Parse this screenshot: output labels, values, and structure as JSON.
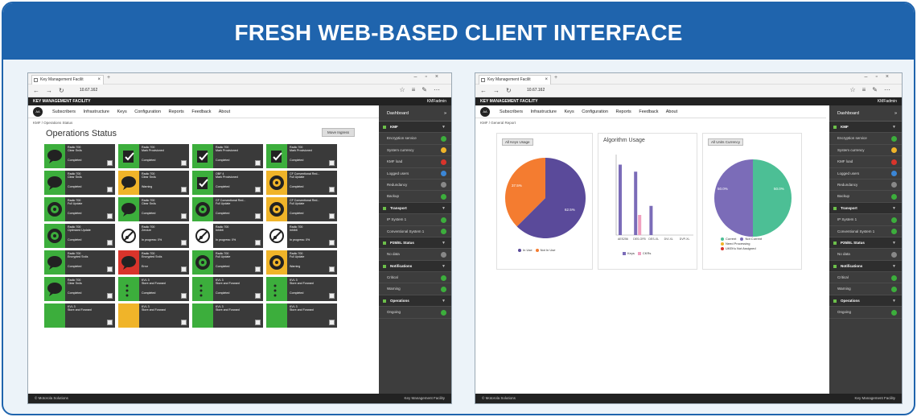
{
  "banner": {
    "title": "FRESH WEB-BASED CLIENT INTERFACE"
  },
  "colors": {
    "brand_blue": "#1f64ad",
    "tile_dark": "#3a3a3a",
    "green": "#3cae3c",
    "yellow": "#f0b429",
    "red": "#d9342b",
    "white": "#ffffff",
    "purple": "#5a4a9a",
    "orange": "#f47c30",
    "lavender": "#7b6cb8",
    "teal": "#4cbf95"
  },
  "left": {
    "tab": {
      "title": "Key Management Facilit"
    },
    "address": {
      "url": "10.67.162"
    },
    "app_header": {
      "title": "KEY MANAGEMENT FACILITY",
      "user": "KMFadmin"
    },
    "logo": "AA",
    "menu": [
      "Subscribers",
      "Infrastructure",
      "Keys",
      "Configuration",
      "Reports",
      "Feedback",
      "About"
    ],
    "breadcrumb": "KMF / Operations Status",
    "page_title": "Operations Status",
    "print_button": "Move Ingress",
    "tiles": [
      {
        "color": "green",
        "icon": "speech",
        "l1": "Radio 700",
        "l2": "Clear Sn4s",
        "l3": "Completed"
      },
      {
        "color": "green",
        "icon": "clipboard",
        "l1": "Radio 700",
        "l2": "Mark Provisioned",
        "l3": "Completed"
      },
      {
        "color": "green",
        "icon": "clipboard",
        "l1": "Radio 700",
        "l2": "Mark Provisioned",
        "l3": "Completed"
      },
      {
        "color": "green",
        "icon": "clipboard",
        "l1": "Radio 700",
        "l2": "Mark Provisioned",
        "l3": "Completed"
      },
      {
        "color": "green",
        "icon": "speech",
        "l1": "Radio 700",
        "l2": "Clear Sn4s",
        "l3": "Completed"
      },
      {
        "color": "yellow",
        "icon": "speech",
        "l1": "Radio 700",
        "l2": "Clear Sn4s",
        "l3": "Warning"
      },
      {
        "color": "green",
        "icon": "clipboard",
        "l1": "OBF 4",
        "l2": "Mark Provisioned",
        "l3": "Completed"
      },
      {
        "color": "yellow",
        "icon": "cycle",
        "l1": "CF Conventional Red...",
        "l2": "Full Update",
        "l3": "Completed"
      },
      {
        "color": "green",
        "icon": "cycle",
        "l1": "Radio 700",
        "l2": "Full Update",
        "l3": "Completed"
      },
      {
        "color": "green",
        "icon": "speech",
        "l1": "Radio 700",
        "l2": "Clear Sn4s",
        "l3": "Completed"
      },
      {
        "color": "green",
        "icon": "cycle",
        "l1": "CF Conventional Red...",
        "l2": "Full Update",
        "l3": "Completed"
      },
      {
        "color": "yellow",
        "icon": "cycle",
        "l1": "CF Conventional Red...",
        "l2": "Full Update",
        "l3": "Completed"
      },
      {
        "color": "green",
        "icon": "cycle",
        "l1": "Radio 700",
        "l2": "Optimized Update",
        "l3": "Completed"
      },
      {
        "color": "white",
        "icon": "nokey",
        "l1": "Radio 700",
        "l2": "Zeroize",
        "l3": "In progress: 0%"
      },
      {
        "color": "white",
        "icon": "nokey",
        "l1": "Radio 700",
        "l2": "Inhibit",
        "l3": "In progress: 0%"
      },
      {
        "color": "white",
        "icon": "nokey",
        "l1": "Radio 700",
        "l2": "Inhibit",
        "l3": "In progress: 0%"
      },
      {
        "color": "green",
        "icon": "speech",
        "l1": "Radio 700",
        "l2": "Encrypted Sn4s",
        "l3": "Completed"
      },
      {
        "color": "red",
        "icon": "speech",
        "l1": "Radio 700",
        "l2": "Encrypted Sn4s",
        "l3": "Error"
      },
      {
        "color": "green",
        "icon": "cycle",
        "l1": "Radio 700",
        "l2": "Full Update",
        "l3": "Completed"
      },
      {
        "color": "yellow",
        "icon": "cycle",
        "l1": "Radio 700",
        "l2": "Full Update",
        "l3": "Warning"
      },
      {
        "color": "green",
        "icon": "speech",
        "l1": "Radio 700",
        "l2": "Clear Sn4s",
        "l3": "Completed"
      },
      {
        "color": "green",
        "icon": "dots",
        "l1": "KVL 3",
        "l2": "Store and Forward",
        "l3": "Completed"
      },
      {
        "color": "green",
        "icon": "dots",
        "l1": "KVL 3",
        "l2": "Store and Forward",
        "l3": "Completed"
      },
      {
        "color": "green",
        "icon": "dots",
        "l1": "KVL 3",
        "l2": "Store and Forward",
        "l3": "Completed"
      },
      {
        "color": "green",
        "icon": "none",
        "l1": "KVL 3",
        "l2": "Store and Forward",
        "l3": ""
      },
      {
        "color": "yellow",
        "icon": "none",
        "l1": "KVL 3",
        "l2": "Store and Forward",
        "l3": ""
      },
      {
        "color": "green",
        "icon": "none",
        "l1": "KVL 3",
        "l2": "Store and Forward",
        "l3": ""
      },
      {
        "color": "green",
        "icon": "none",
        "l1": "KVL 3",
        "l2": "Store and Forward",
        "l3": ""
      }
    ],
    "footer": {
      "left": "© Motorola Solutions",
      "right": "Key Management Facility"
    }
  },
  "right": {
    "tab": {
      "title": "Key Management Facilit"
    },
    "address": {
      "url": "10.67.162"
    },
    "app_header": {
      "title": "KEY MANAGEMENT FACILITY",
      "user": "KMFadmin"
    },
    "logo": "AA",
    "menu": [
      "Subscribers",
      "Infrastructure",
      "Keys",
      "Configuration",
      "Reports",
      "Feedback",
      "About"
    ],
    "breadcrumb": "KMF / General Report",
    "reports": {
      "keys_usage": {
        "dropdown": "All Keys Usage",
        "labels": [
          "37.5%",
          "62.5%"
        ],
        "legend": [
          "In Use",
          "Not In Use"
        ]
      },
      "algorithm_usage": {
        "title": "Algorithm Usage",
        "legend": [
          "Keys",
          "CKRs"
        ]
      },
      "units_currency": {
        "dropdown": "All Units Currency",
        "labels": [
          "50.0%",
          "50.0%"
        ],
        "legend": [
          "Current",
          "Not Current",
          "Need Processing",
          "UKEKs Not Assigned"
        ]
      }
    },
    "footer": {
      "left": "© Motorola Solutions",
      "right": "Key Management Facility"
    }
  },
  "sidebar": {
    "title": "Dashboard",
    "rows": [
      {
        "type": "sec",
        "label": "KMF"
      },
      {
        "type": "item",
        "label": "Encryption service",
        "status": "green"
      },
      {
        "type": "item",
        "label": "System currency",
        "status": "yellow"
      },
      {
        "type": "item",
        "label": "KMF load",
        "status": "red"
      },
      {
        "type": "item",
        "label": "Logged users",
        "status": "blue"
      },
      {
        "type": "item",
        "label": "Redundancy",
        "status": "gray"
      },
      {
        "type": "item",
        "label": "Backup",
        "status": "green"
      },
      {
        "type": "sec",
        "label": "Transport"
      },
      {
        "type": "item",
        "label": "IP System 1",
        "status": "green"
      },
      {
        "type": "item",
        "label": "Conventional System 1",
        "status": "green"
      },
      {
        "type": "sec",
        "label": "P25/EL Status"
      },
      {
        "type": "item",
        "label": "No data",
        "status": "gray"
      },
      {
        "type": "sec",
        "label": "Notifications"
      },
      {
        "type": "item",
        "label": "Critical",
        "status": "green"
      },
      {
        "type": "item",
        "label": "Warning",
        "status": "green"
      },
      {
        "type": "sec",
        "label": "Operations"
      },
      {
        "type": "item",
        "label": "Ongoing",
        "status": "green"
      }
    ]
  },
  "chart_data": [
    {
      "type": "pie",
      "title": "",
      "labels": [
        "Not In Use",
        "In Use"
      ],
      "values": [
        37.5,
        62.5
      ],
      "colors": [
        "#f47c30",
        "#5a4a9a"
      ]
    },
    {
      "type": "bar",
      "title": "Algorithm Usage",
      "categories": [
        "AES256",
        "DES-OFB",
        "DES-XL",
        "DVI-XL",
        "DVP-XL"
      ],
      "series": [
        {
          "name": "Keys",
          "values": [
            70,
            63,
            29,
            0,
            0
          ]
        },
        {
          "name": "CKRs",
          "values": [
            0,
            20,
            0,
            0,
            0
          ]
        }
      ]
    },
    {
      "type": "pie",
      "title": "",
      "labels": [
        "Current",
        "Not Current"
      ],
      "values": [
        50,
        50
      ],
      "colors": [
        "#4cbf95",
        "#7b6cb8"
      ]
    }
  ]
}
